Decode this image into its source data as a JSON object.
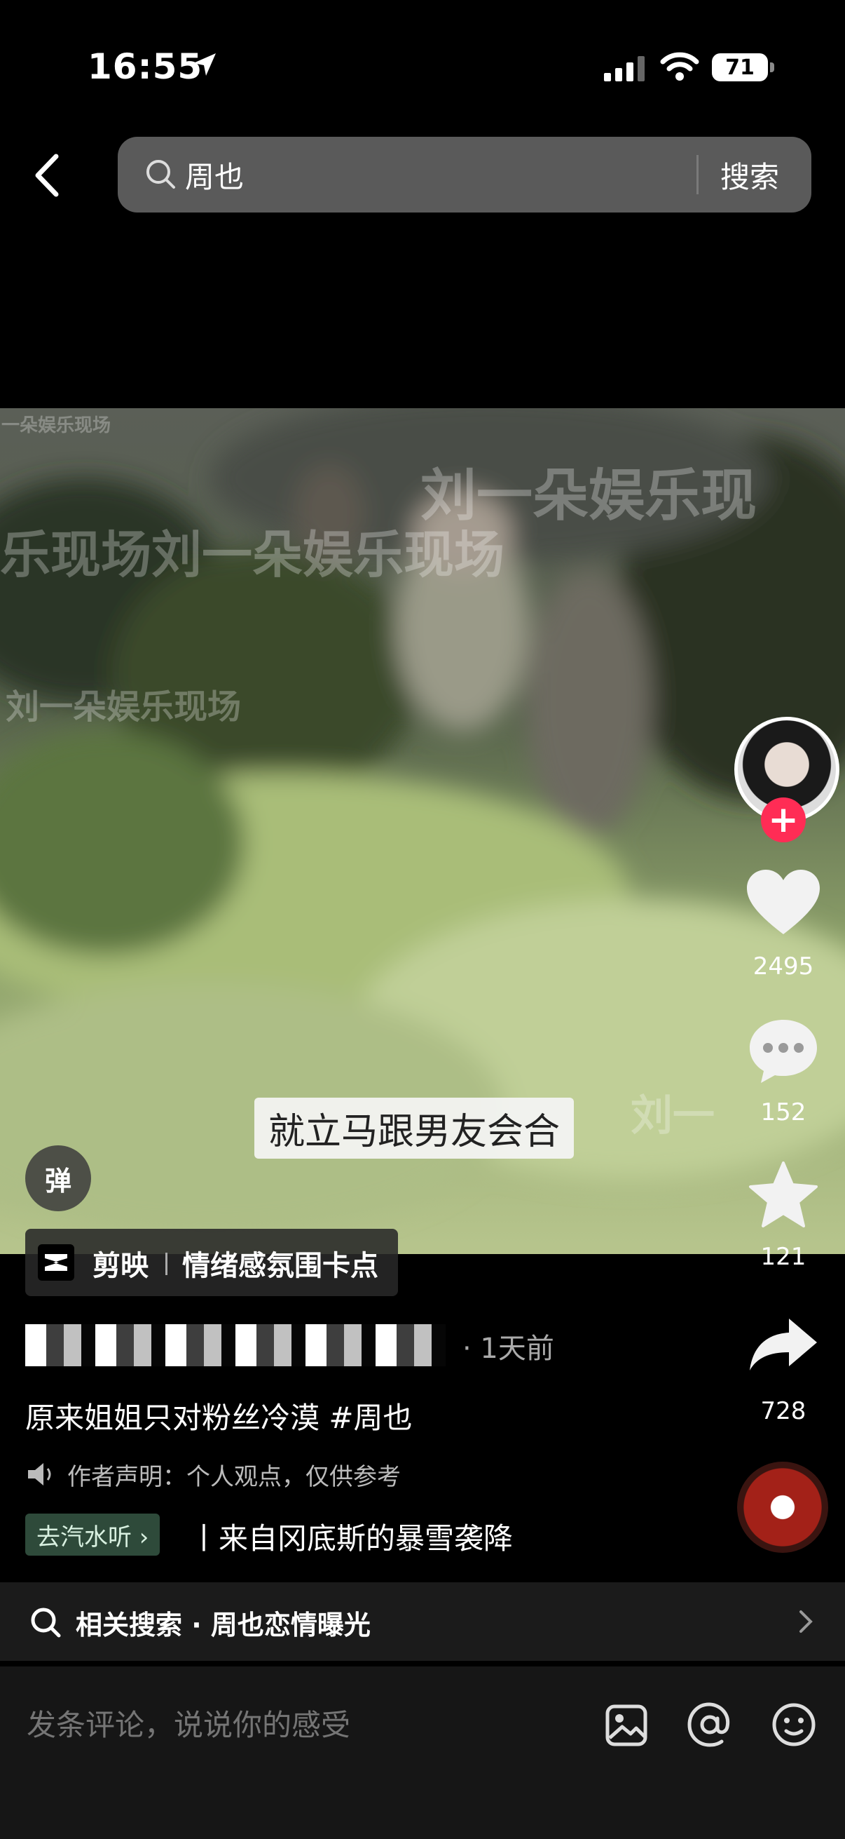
{
  "status_bar": {
    "time": "16:55",
    "battery": "71"
  },
  "search": {
    "query": "周也",
    "button_label": "搜索"
  },
  "video": {
    "watermarks": [
      "一朵娱乐现场",
      "刘一朵娱乐现",
      "乐现场刘一朵娱乐现场",
      "刘一朵娱乐现场",
      "刘一"
    ],
    "subtitle": "就立马跟男友会合"
  },
  "actions": {
    "likes": "2495",
    "comments": "152",
    "favorites": "121",
    "shares": "728"
  },
  "danmu": {
    "label": "弹"
  },
  "capcut": {
    "app": "剪映",
    "template": "情绪感氛围卡点"
  },
  "post": {
    "time": "· 1天前",
    "caption": "原来姐姐只对粉丝冷漠 #周也",
    "declaration": "作者声明：个人观点，仅供参考",
    "music_pill": "去汽水听 ›",
    "music_title": "丨来自冈底斯的暴雪袭降"
  },
  "related": {
    "text": "相关搜索 · 周也恋情曝光"
  },
  "comment": {
    "placeholder": "发条评论，说说你的感受"
  },
  "colors": {
    "accent": "#ff2c55",
    "music_pill": "#2e4a3a"
  }
}
